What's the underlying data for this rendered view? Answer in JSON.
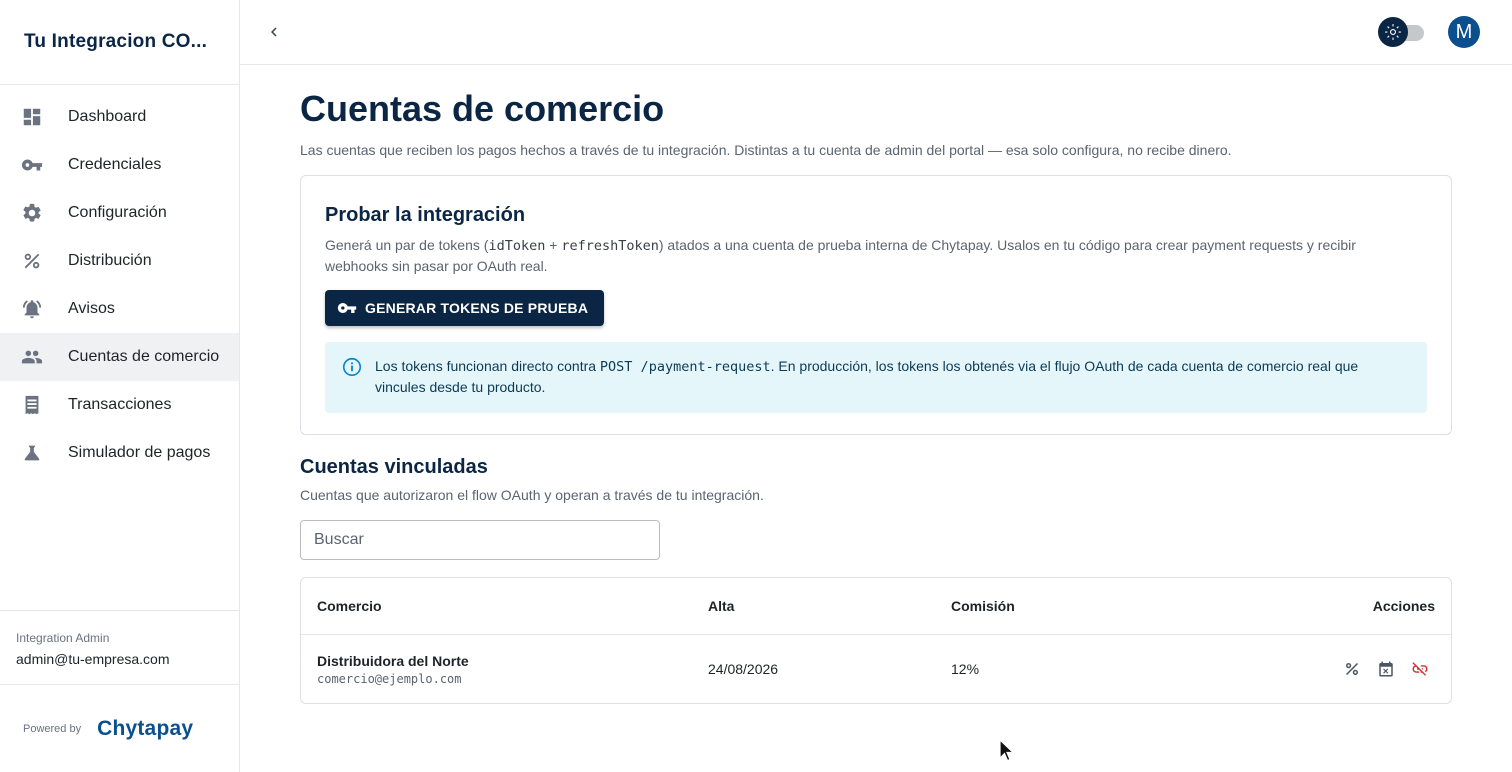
{
  "sidebar": {
    "brand": "Tu Integracion CO...",
    "items": [
      {
        "label": "Dashboard",
        "icon": "dashboard-icon"
      },
      {
        "label": "Credenciales",
        "icon": "key-icon"
      },
      {
        "label": "Configuración",
        "icon": "gear-icon"
      },
      {
        "label": "Distribución",
        "icon": "percent-icon"
      },
      {
        "label": "Avisos",
        "icon": "bell-icon"
      },
      {
        "label": "Cuentas de comercio",
        "icon": "people-icon",
        "active": true
      },
      {
        "label": "Transacciones",
        "icon": "receipt-icon"
      },
      {
        "label": "Simulador de pagos",
        "icon": "flask-icon"
      }
    ],
    "footer": {
      "role": "Integration Admin",
      "email": "admin@tu-empresa.com"
    },
    "powered_by": "Powered by",
    "powered_brand": "Chytapay"
  },
  "topbar": {
    "avatar_letter": "M"
  },
  "page": {
    "title": "Cuentas de comercio",
    "subtitle": "Las cuentas que reciben los pagos hechos a través de tu integración. Distintas a tu cuenta de admin del portal — esa solo configura, no recibe dinero."
  },
  "test_card": {
    "title": "Probar la integración",
    "desc_1": "Generá un par de tokens (",
    "code_1": "idToken",
    "desc_2": " + ",
    "code_2": "refreshToken",
    "desc_3": ") atados a una cuenta de prueba interna de Chytapay. Usalos en tu código para crear payment requests y recibir webhooks sin pasar por OAuth real.",
    "button_label": "GENERAR TOKENS DE PRUEBA",
    "info_1": "Los tokens funcionan directo contra ",
    "info_code": "POST /payment-request",
    "info_2": ". En producción, los tokens los obtenés via el flujo OAuth de cada cuenta de comercio real que vincules desde tu producto."
  },
  "linked": {
    "title": "Cuentas vinculadas",
    "subtitle": "Cuentas que autorizaron el flow OAuth y operan a través de tu integración.",
    "search_placeholder": "Buscar",
    "columns": [
      "Comercio",
      "Alta",
      "Comisión",
      "Acciones"
    ],
    "rows": [
      {
        "name": "Distribuidora del Norte",
        "email": "comercio@ejemplo.com",
        "alta": "24/08/2026",
        "comision": "12%"
      }
    ]
  },
  "colors": {
    "primary": "#0b2545",
    "accent": "#0b4f8f",
    "info_bg": "#e5f6fb",
    "danger": "#d32f2f"
  }
}
